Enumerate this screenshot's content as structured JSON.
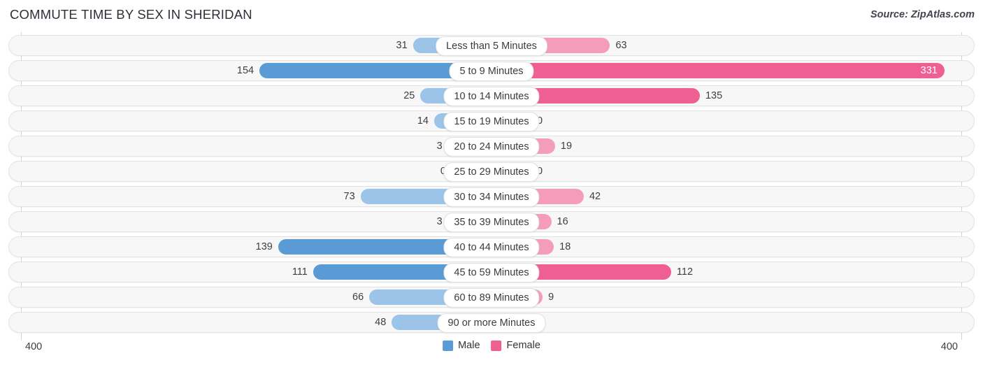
{
  "header": {
    "title": "COMMUTE TIME BY SEX IN SHERIDAN",
    "source": "Source: ZipAtlas.com"
  },
  "axis": {
    "left_tick": "400",
    "right_tick": "400"
  },
  "legend": {
    "items": [
      {
        "label": "Male",
        "color": "#5b9bd5"
      },
      {
        "label": "Female",
        "color": "#ef5f92"
      }
    ]
  },
  "colors": {
    "male_strong": "#5b9bd5",
    "male_light": "#9cc3e8",
    "female_strong": "#ef5f92",
    "female_light": "#f59cba",
    "track_bg": "#f7f7f8",
    "track_border": "#e3e3e6",
    "axis": "#d2d2d6"
  },
  "chart_data": {
    "type": "bar",
    "title": "COMMUTE TIME BY SEX IN SHERIDAN",
    "subtitle": "Source: ZipAtlas.com",
    "orientation": "horizontal-diverging",
    "xlabel": "",
    "ylabel": "",
    "xlim": [
      400,
      400
    ],
    "grid": false,
    "legend_position": "bottom-center",
    "categories": [
      "Less than 5 Minutes",
      "5 to 9 Minutes",
      "10 to 14 Minutes",
      "15 to 19 Minutes",
      "20 to 24 Minutes",
      "25 to 29 Minutes",
      "30 to 34 Minutes",
      "35 to 39 Minutes",
      "40 to 44 Minutes",
      "45 to 59 Minutes",
      "60 to 89 Minutes",
      "90 or more Minutes"
    ],
    "series": [
      {
        "name": "Male",
        "values": [
          31,
          154,
          25,
          14,
          3,
          0,
          73,
          3,
          139,
          111,
          66,
          48
        ]
      },
      {
        "name": "Female",
        "values": [
          63,
          331,
          135,
          0,
          19,
          0,
          42,
          16,
          18,
          112,
          9,
          0
        ]
      }
    ]
  },
  "rows": [
    {
      "label": "Less than 5 Minutes",
      "male": "31",
      "female": "63",
      "male_v": 31,
      "female_v": 63
    },
    {
      "label": "5 to 9 Minutes",
      "male": "154",
      "female": "331",
      "male_v": 154,
      "female_v": 331
    },
    {
      "label": "10 to 14 Minutes",
      "male": "25",
      "female": "135",
      "male_v": 25,
      "female_v": 135
    },
    {
      "label": "15 to 19 Minutes",
      "male": "14",
      "female": "0",
      "male_v": 14,
      "female_v": 0
    },
    {
      "label": "20 to 24 Minutes",
      "male": "3",
      "female": "19",
      "male_v": 3,
      "female_v": 19
    },
    {
      "label": "25 to 29 Minutes",
      "male": "0",
      "female": "0",
      "male_v": 0,
      "female_v": 0
    },
    {
      "label": "30 to 34 Minutes",
      "male": "73",
      "female": "42",
      "male_v": 73,
      "female_v": 42
    },
    {
      "label": "35 to 39 Minutes",
      "male": "3",
      "female": "16",
      "male_v": 3,
      "female_v": 16
    },
    {
      "label": "40 to 44 Minutes",
      "male": "139",
      "female": "18",
      "male_v": 139,
      "female_v": 18
    },
    {
      "label": "45 to 59 Minutes",
      "male": "111",
      "female": "112",
      "male_v": 111,
      "female_v": 112
    },
    {
      "label": "60 to 89 Minutes",
      "male": "66",
      "female": "9",
      "male_v": 66,
      "female_v": 9
    },
    {
      "label": "90 or more Minutes",
      "male": "48",
      "female": "0",
      "male_v": 48,
      "female_v": 0
    }
  ]
}
